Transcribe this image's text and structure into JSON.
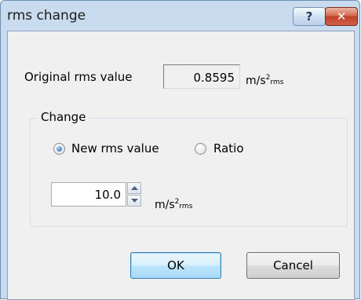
{
  "window": {
    "title": "rms change"
  },
  "titlebar": {
    "help_glyph": "?",
    "close_glyph": "✕"
  },
  "original": {
    "label": "Original rms value",
    "value": "0.8595",
    "unit_base": "m/s",
    "unit_sup": "2",
    "unit_suffix": "rms"
  },
  "change_group": {
    "title": "Change",
    "options": [
      {
        "label": "New rms value",
        "selected": true
      },
      {
        "label": "Ratio",
        "selected": false
      }
    ],
    "input_value": "10.0",
    "unit_base": "m/s",
    "unit_sup": "2",
    "unit_suffix": "rms"
  },
  "buttons": {
    "ok": "OK",
    "cancel": "Cancel"
  },
  "colors": {
    "close_red": "#c04128",
    "accent_blue": "#3c7fb1",
    "title_frame": "#c9dbee"
  }
}
